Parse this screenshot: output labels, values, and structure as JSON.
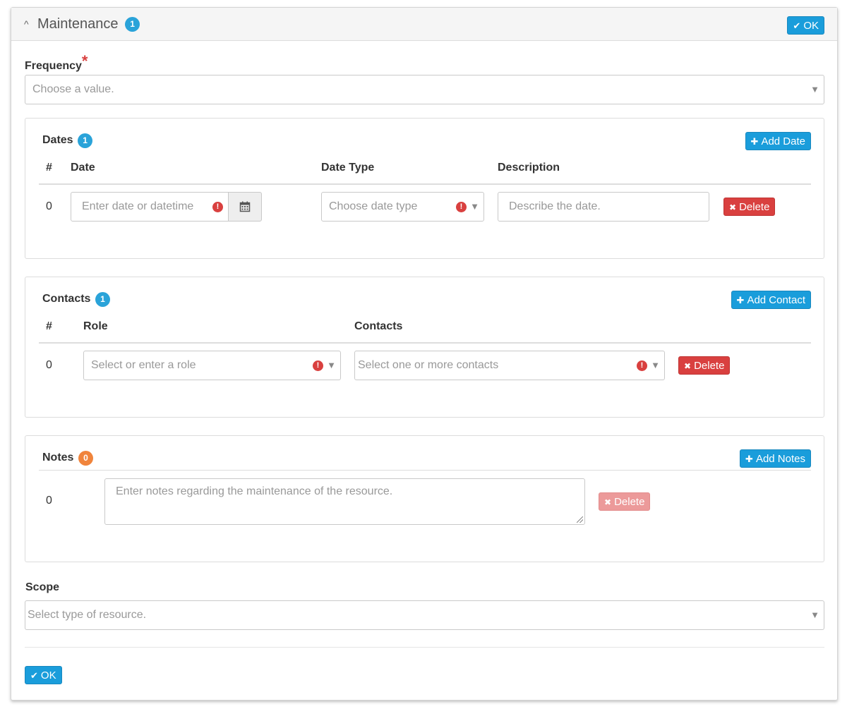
{
  "section": {
    "title": "Maintenance",
    "count": "1",
    "ok_label": "OK"
  },
  "frequency": {
    "label": "Frequency",
    "required_mark": "*",
    "placeholder": "Choose a value."
  },
  "dates": {
    "title": "Dates",
    "count": "1",
    "add_label": "Add Date",
    "columns": [
      "#",
      "Date",
      "Date Type",
      "Description"
    ],
    "rows": [
      {
        "index": "0",
        "date_placeholder": "Enter date or datetime",
        "type_placeholder": "Choose date type",
        "description_placeholder": "Describe the date.",
        "delete_label": "Delete"
      }
    ]
  },
  "contacts": {
    "title": "Contacts",
    "count": "1",
    "add_label": "Add Contact",
    "columns": [
      "#",
      "Role",
      "Contacts"
    ],
    "rows": [
      {
        "index": "0",
        "role_placeholder": "Select or enter a role",
        "contacts_placeholder": "Select one or more contacts",
        "delete_label": "Delete"
      }
    ]
  },
  "notes": {
    "title": "Notes",
    "count": "0",
    "add_label": "Add Notes",
    "rows": [
      {
        "index": "0",
        "placeholder": "Enter notes regarding the maintenance of the resource.",
        "delete_label": "Delete"
      }
    ]
  },
  "scope": {
    "label": "Scope",
    "placeholder": "Select type of resource."
  },
  "footer": {
    "ok_label": "OK"
  },
  "icons": {
    "warning": "!",
    "dropdown": "▼",
    "collapse": "^",
    "calendar": "calendar-icon"
  },
  "colors": {
    "primary": "#1a9ddb",
    "danger": "#d9403f",
    "badge_blue": "#2aa3d9",
    "badge_orange": "#f0843c"
  }
}
